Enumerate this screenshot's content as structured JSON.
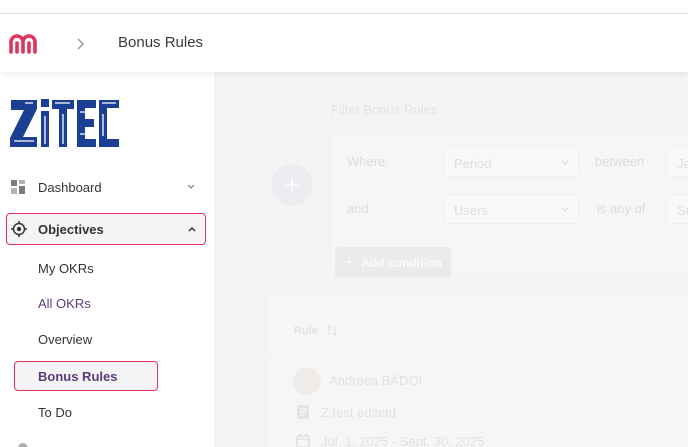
{
  "header": {
    "title": "Bonus Rules",
    "brand_color": "#e0335e"
  },
  "sidebar": {
    "items": [
      {
        "label": "Dashboard",
        "icon": "dashboard-grid-icon"
      },
      {
        "label": "Objectives",
        "icon": "target-icon"
      }
    ],
    "subitems": [
      {
        "label": "My OKRs"
      },
      {
        "label": "All OKRs"
      },
      {
        "label": "Overview"
      },
      {
        "label": "Bonus Rules"
      },
      {
        "label": "To Do"
      }
    ],
    "highlight_color": "#e0335e",
    "active_color": "#5c3b7a"
  },
  "filter": {
    "title": "Filter Bonus Rules",
    "rows": [
      {
        "prefix": "Where:",
        "field": "Period",
        "operator": "between",
        "value": "Ja"
      },
      {
        "prefix": "and",
        "field": "Users",
        "operator": "is any of",
        "value": "Se"
      }
    ],
    "add_condition_label": "Add condition"
  },
  "table": {
    "column_rule": "Rule",
    "row": {
      "user": "Andreea BĂDOI",
      "objective": "Z test editetd",
      "period": "Jul. 1, 2025 - Sept. 30, 2025"
    }
  }
}
